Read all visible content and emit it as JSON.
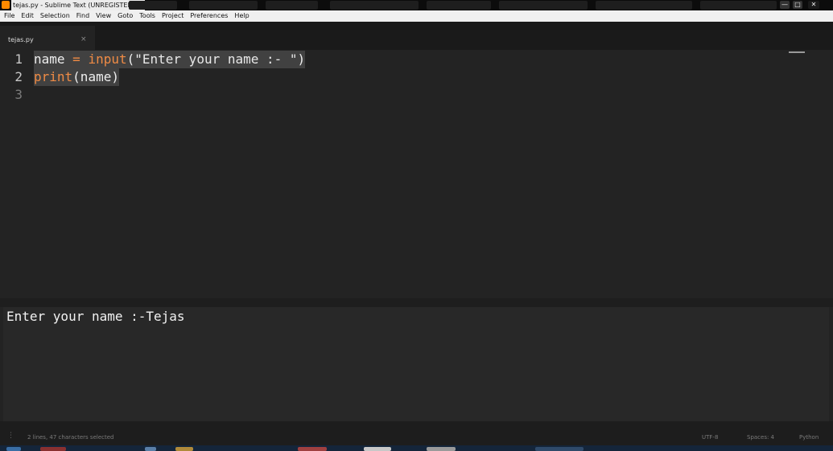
{
  "window": {
    "title": "tejas.py - Sublime Text (UNREGISTERED)",
    "controls": {
      "minimize": "—",
      "maximize": "□",
      "close": "✕"
    }
  },
  "menu": [
    "File",
    "Edit",
    "Selection",
    "Find",
    "View",
    "Goto",
    "Tools",
    "Project",
    "Preferences",
    "Help"
  ],
  "tabs": [
    {
      "label": "tejas.py",
      "close": "×"
    }
  ],
  "editor": {
    "line_numbers": [
      "1",
      "2",
      "3"
    ],
    "line1": {
      "ident": "name",
      "op": " = ",
      "func": "input",
      "open": "(",
      "string": "\"Enter your name :- \"",
      "close": ")"
    },
    "line2": {
      "func": "print",
      "args": "(name)"
    },
    "line3": ""
  },
  "output": {
    "text": "Enter your name :-Tejas"
  },
  "status": {
    "selection": "2 lines, 47 characters selected",
    "encoding": "UTF-8",
    "indentation": "Spaces: 4",
    "syntax": "Python"
  },
  "colors": {
    "editor_bg": "#232323",
    "keyword": "#ef8b45",
    "text": "#eeeeee",
    "selection": "#414141",
    "line_number": "#7b7b7b"
  }
}
